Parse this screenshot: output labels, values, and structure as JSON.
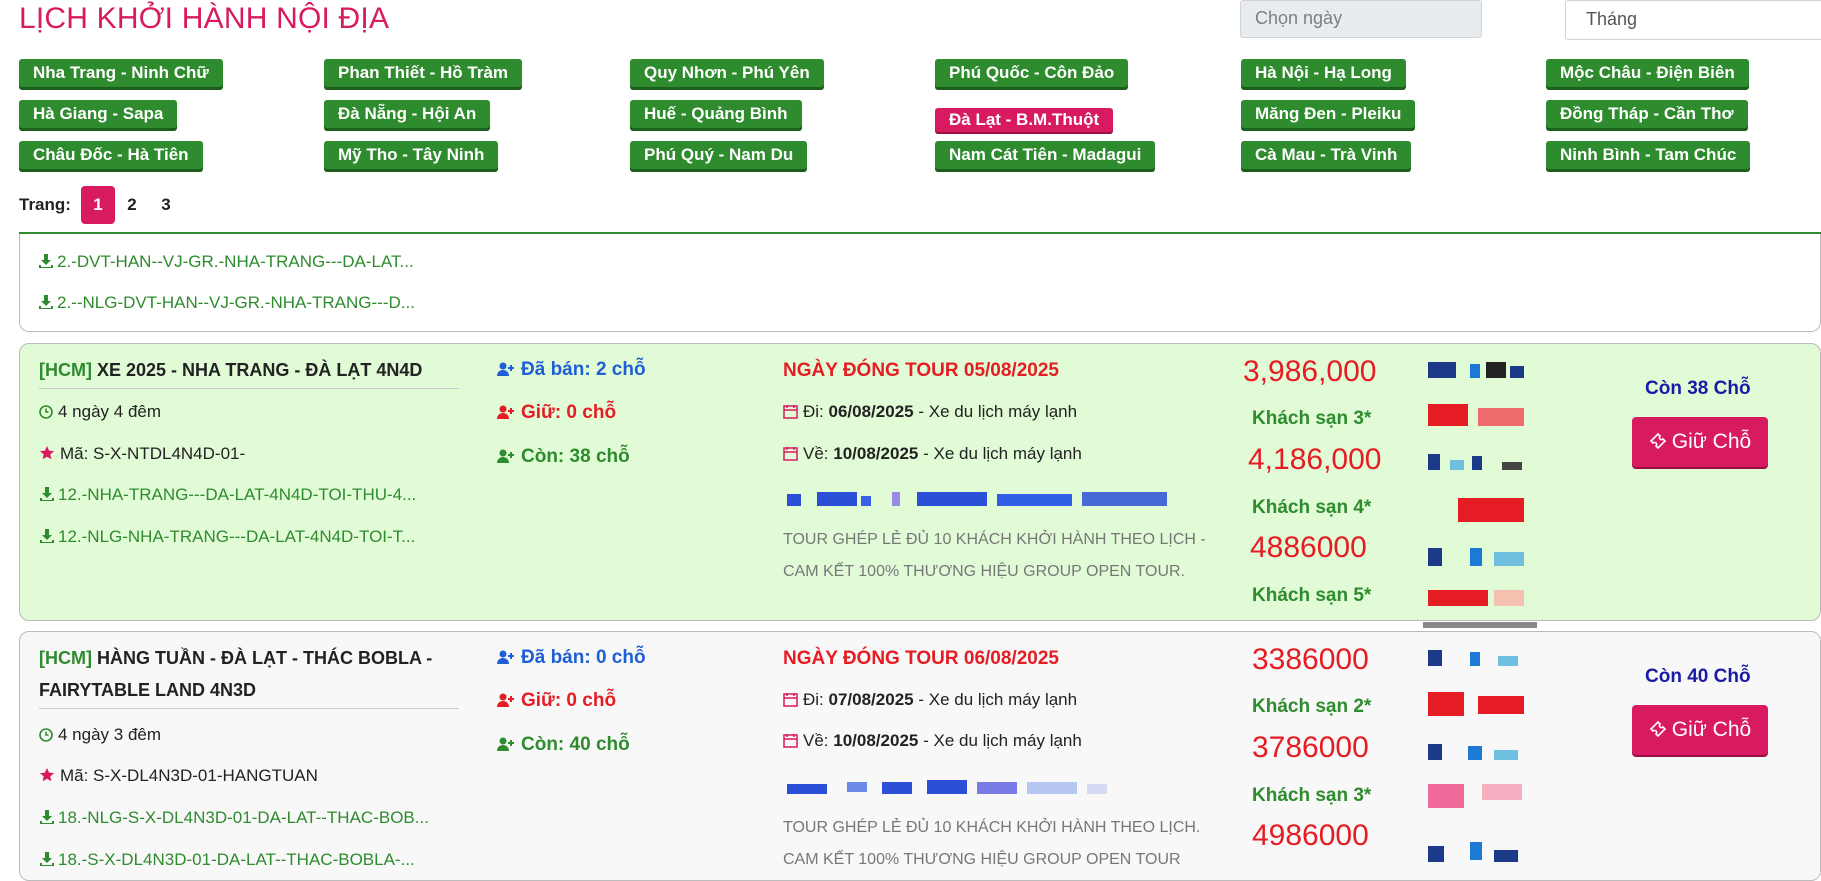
{
  "header": {
    "title": "LỊCH KHỞI HÀNH NỘI ĐỊA",
    "date_placeholder": "Chọn ngày",
    "month_select": "Tháng"
  },
  "routes": [
    {
      "label": "Nha Trang - Ninh Chữ",
      "active": false
    },
    {
      "label": "Phan Thiết - Hồ Tràm",
      "active": false
    },
    {
      "label": "Quy Nhơn - Phú Yên",
      "active": false
    },
    {
      "label": "Phú Quốc - Côn Đảo",
      "active": false
    },
    {
      "label": "Hà Nội - Hạ Long",
      "active": false
    },
    {
      "label": "Mộc Châu - Điện Biên",
      "active": false
    },
    {
      "label": "Hà Giang - Sapa",
      "active": false
    },
    {
      "label": "Đà Nẵng - Hội An",
      "active": false
    },
    {
      "label": "Huế - Quảng Bình",
      "active": false
    },
    {
      "label": "Đà Lạt - B.M.Thuột",
      "active": true
    },
    {
      "label": "Măng Đen - Pleiku",
      "active": false
    },
    {
      "label": "Đồng Tháp - Cần Thơ",
      "active": false
    },
    {
      "label": "Châu Đốc - Hà Tiên",
      "active": false
    },
    {
      "label": "Mỹ Tho - Tây Ninh",
      "active": false
    },
    {
      "label": "Phú Quý - Nam Du",
      "active": false
    },
    {
      "label": "Nam Cát Tiên - Madagui",
      "active": false
    },
    {
      "label": "Cà Mau - Trà Vinh",
      "active": false
    },
    {
      "label": "Ninh Bình - Tam Chúc",
      "active": false
    }
  ],
  "pagination": {
    "label": "Trang:",
    "pages": [
      "1",
      "2",
      "3"
    ],
    "current": "1"
  },
  "top_files": [
    "2.-DVT-HAN--VJ-GR.-NHA-TRANG---DA-LAT...",
    "2.--NLG-DVT-HAN--VJ-GR.-NHA-TRANG---D..."
  ],
  "tours": [
    {
      "tag": "[HCM]",
      "name": "XE 2025 - NHA TRANG - ĐÀ LẠT 4N4D",
      "duration": "4 ngày 4 đêm",
      "code": "Mã: S-X-NTDL4N4D-01-",
      "files": [
        "12.-NHA-TRANG---DA-LAT-4N4D-TOI-THU-4...",
        "12.-NLG-NHA-TRANG---DA-LAT-4N4D-TOI-T..."
      ],
      "sold": "Đã bán: 2 chỗ",
      "held": "Giữ: 0 chỗ",
      "remaining": "Còn: 38 chỗ",
      "close_date": "NGÀY ĐÓNG TOUR 05/08/2025",
      "depart_prefix": "Đi:",
      "depart_date": "06/08/2025",
      "depart_vehicle": "- Xe du lịch máy lạnh",
      "return_prefix": "Về:",
      "return_date": "10/08/2025",
      "return_vehicle": "- Xe du lịch máy lạnh",
      "note_line1": "TOUR GHÉP LẺ ĐỦ 10 KHÁCH KHỞI HÀNH THEO LỊCH -",
      "note_line2": "CAM KẾT 100% THƯƠNG HIỆU GROUP OPEN TOUR.",
      "prices": [
        {
          "price": "3,986,000",
          "hotel": "Khách sạn 3*"
        },
        {
          "price": "4,186,000",
          "hotel": "Khách sạn 4*"
        },
        {
          "price": "4886000",
          "hotel": "Khách sạn 5*"
        }
      ],
      "seats_left": "Còn 38 Chỗ",
      "hold_label": "Giữ Chỗ",
      "bg": "#e2fbd7"
    },
    {
      "tag": "[HCM]",
      "name": "HÀNG TUẦN - ĐÀ LẠT - THÁC BOBLA - FAIRYTABLE LAND 4N3D",
      "duration": "4 ngày 3 đêm",
      "code": "Mã: S-X-DL4N3D-01-HANGTUAN",
      "files": [
        "18.-NLG-S-X-DL4N3D-01-DA-LAT--THAC-BOB...",
        "18.-S-X-DL4N3D-01-DA-LAT--THAC-BOBLA-..."
      ],
      "sold": "Đã bán: 0 chỗ",
      "held": "Giữ: 0 chỗ",
      "remaining": "Còn: 40 chỗ",
      "close_date": "NGÀY ĐÓNG TOUR 06/08/2025",
      "depart_prefix": "Đi:",
      "depart_date": "07/08/2025",
      "depart_vehicle": "- Xe du lịch máy lạnh",
      "return_prefix": "Về:",
      "return_date": "10/08/2025",
      "return_vehicle": "- Xe du lịch máy lạnh",
      "note_line1": "TOUR GHÉP LẺ ĐỦ 10 KHÁCH KHỞI HÀNH THEO LỊCH.",
      "note_line2": "CAM KẾT 100% THƯƠNG HIỆU GROUP OPEN TOUR",
      "prices": [
        {
          "price": "3386000",
          "hotel": "Khách sạn 2*"
        },
        {
          "price": "3786000",
          "hotel": "Khách sạn 3*"
        },
        {
          "price": "4986000",
          "hotel": ""
        }
      ],
      "seats_left": "Còn 40 Chỗ",
      "hold_label": "Giữ Chỗ",
      "bg": "#f8f8f8"
    }
  ],
  "colors": {
    "brand_pink": "#d81b60",
    "route_green": "#2e8b2e",
    "price_red": "#e51c23",
    "seat_blue": "#1a1aa6",
    "sold_blue": "#1e5fd6"
  },
  "icons": [
    "download-icon",
    "clock-icon",
    "star-icon",
    "user-plus-icon",
    "calendar-icon",
    "ticket-icon"
  ]
}
